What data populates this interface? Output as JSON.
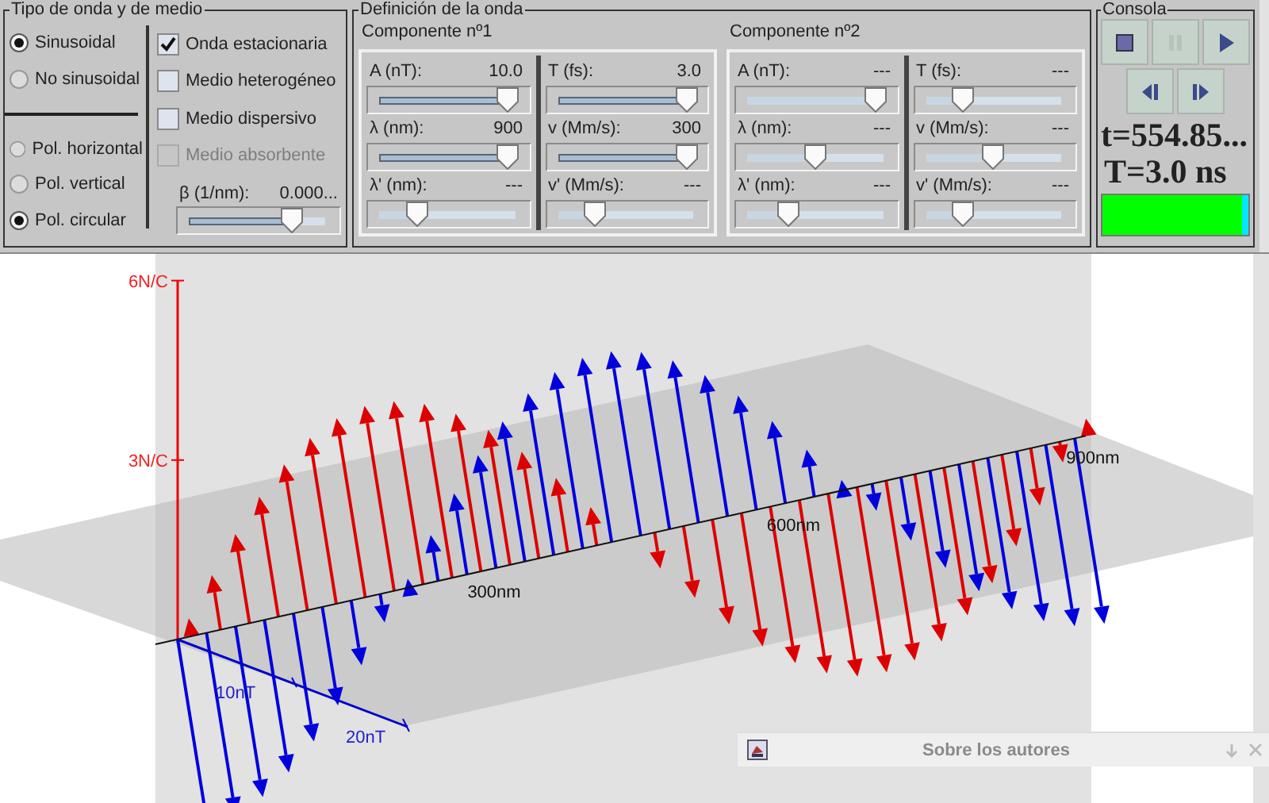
{
  "wave_group": {
    "title": "Tipo de onda y de medio",
    "wave_type": [
      {
        "label": "Sinusoidal",
        "selected": true
      },
      {
        "label": "No sinusoidal",
        "selected": false
      }
    ],
    "polarization": [
      {
        "label": "Pol. horizontal",
        "selected": false
      },
      {
        "label": "Pol. vertical",
        "selected": false
      },
      {
        "label": "Pol. circular",
        "selected": true
      }
    ],
    "medium_options": [
      {
        "label": "Onda estacionaria",
        "checked": true,
        "disabled": false
      },
      {
        "label": "Medio heterogéneo",
        "checked": false,
        "disabled": false
      },
      {
        "label": "Medio dispersivo",
        "checked": false,
        "disabled": false
      },
      {
        "label": "Medio absorbente",
        "checked": false,
        "disabled": true
      }
    ],
    "beta": {
      "label": "β (1/nm):",
      "value": "0.000...",
      "level": 0.75
    }
  },
  "definition_group": {
    "title": "Definición de la onda",
    "components": [
      {
        "title": "Componente nº1",
        "params": [
          {
            "label": "A (nT):",
            "value": "10.0",
            "level": 0.95,
            "disabled": false
          },
          {
            "label": "T (fs):",
            "value": "3.0",
            "level": 0.95,
            "disabled": false
          },
          {
            "label": "λ (nm):",
            "value": "900",
            "level": 0.95,
            "disabled": false
          },
          {
            "label": "v (Mm/s):",
            "value": "300",
            "level": 0.95,
            "disabled": false
          },
          {
            "label": "λ' (nm):",
            "value": "---",
            "level": 0.28,
            "disabled": true
          },
          {
            "label": "v' (Mm/s):",
            "value": "---",
            "level": 0.28,
            "disabled": true
          }
        ]
      },
      {
        "title": "Componente nº2",
        "params": [
          {
            "label": "A (nT):",
            "value": "---",
            "level": 0.95,
            "disabled": true
          },
          {
            "label": "T (fs):",
            "value": "---",
            "level": 0.28,
            "disabled": true
          },
          {
            "label": "λ (nm):",
            "value": "---",
            "level": 0.5,
            "disabled": true
          },
          {
            "label": "v (Mm/s):",
            "value": "---",
            "level": 0.5,
            "disabled": true
          },
          {
            "label": "λ' (nm):",
            "value": "---",
            "level": 0.3,
            "disabled": true
          },
          {
            "label": "v' (Mm/s):",
            "value": "---",
            "level": 0.28,
            "disabled": true
          }
        ]
      }
    ]
  },
  "console": {
    "title": "Consola",
    "buttons": [
      {
        "kind": "stop",
        "disabled": false
      },
      {
        "kind": "pause",
        "disabled": true
      },
      {
        "kind": "play",
        "disabled": false
      },
      {
        "kind": "step_back",
        "disabled": false
      },
      {
        "kind": "step_forward",
        "disabled": false
      }
    ],
    "time": "t=554.85...",
    "period": "T=3.0 ns",
    "progress": {
      "level": 0.96
    }
  },
  "plot": {
    "e_axis_labels": [
      "6N/C",
      "3N/C"
    ],
    "distance_labels": [
      "300nm",
      "600nm",
      "900nm"
    ],
    "b_axis_labels": [
      "10nT",
      "20nT"
    ]
  },
  "notification": {
    "title": "Sobre los autores"
  }
}
